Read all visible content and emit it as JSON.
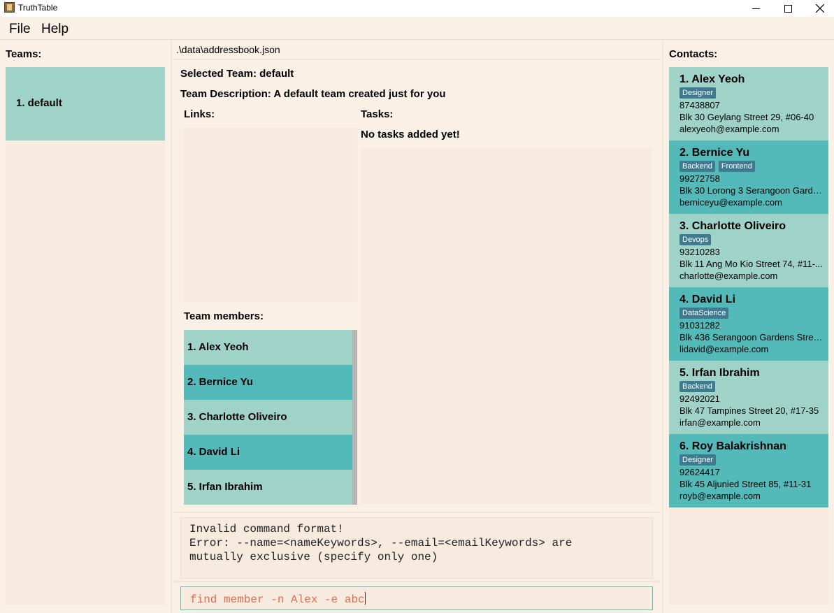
{
  "window": {
    "title": "TruthTable"
  },
  "menu": {
    "file": "File",
    "help": "Help"
  },
  "teams": {
    "label": "Teams:",
    "items": [
      {
        "label": "1. default"
      }
    ]
  },
  "center": {
    "path": ".\\data\\addressbook.json",
    "selected_team": "Selected Team: default",
    "team_description": "Team Description: A default team created just for you",
    "links_label": "Links:",
    "tasks_label": "Tasks:",
    "no_tasks": "No tasks added yet!",
    "members_label": "Team members:",
    "members": [
      {
        "label": "1. Alex Yeoh"
      },
      {
        "label": "2. Bernice Yu"
      },
      {
        "label": "3. Charlotte Oliveiro"
      },
      {
        "label": "4. David Li"
      },
      {
        "label": "5. Irfan Ibrahim"
      }
    ],
    "result_lines": [
      "Invalid command format!",
      "Error: --name=<nameKeywords>, --email=<emailKeywords> are",
      "mutually exclusive (specify only one)"
    ],
    "command": "find member -n Alex -e abc"
  },
  "contacts": {
    "label": "Contacts:",
    "items": [
      {
        "name": "1. Alex Yeoh",
        "tags": [
          "Designer"
        ],
        "phone": "87438807",
        "address": "Blk 30 Geylang Street 29, #06-40",
        "email": "alexyeoh@example.com"
      },
      {
        "name": "2. Bernice Yu",
        "tags": [
          "Backend",
          "Frontend"
        ],
        "phone": "99272758",
        "address": "Blk 30 Lorong 3 Serangoon Garde...",
        "email": "berniceyu@example.com"
      },
      {
        "name": "3. Charlotte Oliveiro",
        "tags": [
          "Devops"
        ],
        "phone": "93210283",
        "address": "Blk 11 Ang Mo Kio Street 74, #11-...",
        "email": "charlotte@example.com"
      },
      {
        "name": "4. David Li",
        "tags": [
          "DataScience"
        ],
        "phone": "91031282",
        "address": "Blk 436 Serangoon Gardens Street...",
        "email": "lidavid@example.com"
      },
      {
        "name": "5. Irfan Ibrahim",
        "tags": [
          "Backend"
        ],
        "phone": "92492021",
        "address": "Blk 47 Tampines Street 20, #17-35",
        "email": "irfan@example.com"
      },
      {
        "name": "6. Roy Balakrishnan",
        "tags": [
          "Designer"
        ],
        "phone": "92624417",
        "address": "Blk 45 Aljunied Street 85, #11-31",
        "email": "royb@example.com"
      }
    ]
  },
  "colors": {
    "card_light": "#a0d3c8",
    "card_dark": "#53b9b9",
    "tag": "#3e7b91",
    "background": "#faf0e6",
    "command_text": "#e06c4a"
  }
}
